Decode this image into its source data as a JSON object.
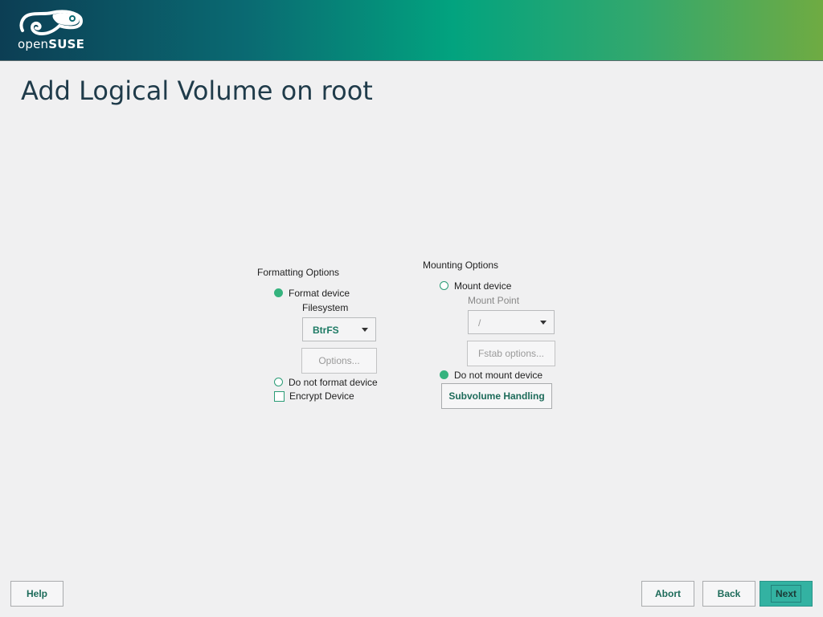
{
  "header": {
    "logo_text_light": "open",
    "logo_text_bold": "SUSE",
    "logo_icon": "opensuse-chameleon-icon"
  },
  "page": {
    "title": "Add Logical Volume on root"
  },
  "formatting": {
    "label": "Formatting Options",
    "format_device": {
      "label": "Format device",
      "selected": true
    },
    "filesystem_label": "Filesystem",
    "filesystem_value": "BtrFS",
    "options_button": "Options...",
    "do_not_format": {
      "label": "Do not format device",
      "selected": false
    },
    "encrypt": {
      "label": "Encrypt Device",
      "checked": false
    }
  },
  "mounting": {
    "label": "Mounting Options",
    "mount_device": {
      "label": "Mount device",
      "selected": false
    },
    "mount_point_label": "Mount Point",
    "mount_point_value": "/",
    "fstab_button": "Fstab options...",
    "do_not_mount": {
      "label": "Do not mount device",
      "selected": true
    },
    "subvolume_button": "Subvolume Handling"
  },
  "footer": {
    "help": "Help",
    "abort": "Abort",
    "back": "Back",
    "next": "Next"
  },
  "colors": {
    "accent": "#35b37e",
    "primary_button": "#33b2a2",
    "title": "#1f3b4a"
  }
}
